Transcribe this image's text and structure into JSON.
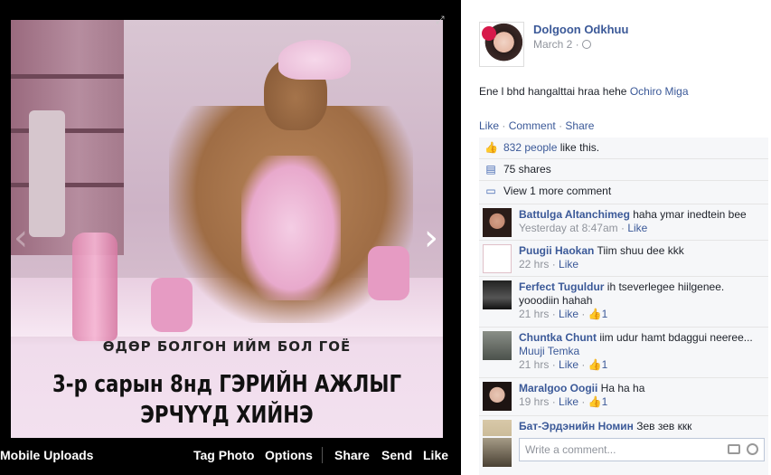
{
  "photo": {
    "caption_line1": "ӨДӨР БОЛГОН ИЙМ БОЛ ГОЁ",
    "caption_line2a": "3-р сарын 8нд ГЭРИЙН АЖЛЫГ",
    "caption_line2b": "ЭРЧҮҮД ХИЙНЭ",
    "prev_arrow": "‹",
    "next_arrow": "›",
    "expand_icon": "⤢"
  },
  "bottom_bar": {
    "album": "Mobile Uploads",
    "tag_photo": "Tag Photo",
    "options": "Options",
    "share": "Share",
    "send": "Send",
    "like": "Like"
  },
  "post": {
    "author": "Dolgoon Odkhuu",
    "date": "March 2 ·",
    "text": "Ene l bhd hangalttai hraa hehe ",
    "tagged": "Ochiro Miga",
    "actions": {
      "like": "Like",
      "comment": "Comment",
      "share": "Share",
      "dot": "·"
    }
  },
  "stats": {
    "likes_link": "832 people",
    "likes_suffix": " like this.",
    "shares": "75 shares",
    "more_comments": "View 1 more comment"
  },
  "comments": [
    {
      "name": "Battulga Altanchimeg",
      "text": " haha ymar inedtein bee",
      "time": "Yesterday at 8:47am",
      "like": "Like",
      "count": ""
    },
    {
      "name": "Puugii Haokan",
      "text": " Tiim shuu dee kkk",
      "time": "22 hrs",
      "like": "Like",
      "count": ""
    },
    {
      "name": "Ferfect Tuguldur",
      "text": " ih tseverlegee hiilgenee. yooodiin hahah",
      "time": "21 hrs",
      "like": "Like",
      "count": "1"
    },
    {
      "name": "Chuntka Chunt",
      "text": " iim udur hamt bdaggui neeree... ",
      "mention": "Muuji Temka",
      "time": "21 hrs",
      "like": "Like",
      "count": "1"
    },
    {
      "name": "Maralgoo Oogii",
      "text": " Ha ha ha",
      "time": "19 hrs",
      "like": "Like",
      "count": "1"
    },
    {
      "name": "Бат-Эрдэнийн Номин",
      "text": " Зев зев ккк",
      "time": "",
      "like": "",
      "count": ""
    }
  ],
  "composer": {
    "placeholder": "Write a comment..."
  },
  "colors": {
    "link": "#3b5998",
    "muted": "#90949c",
    "ufi_bg": "#f6f7f9"
  }
}
